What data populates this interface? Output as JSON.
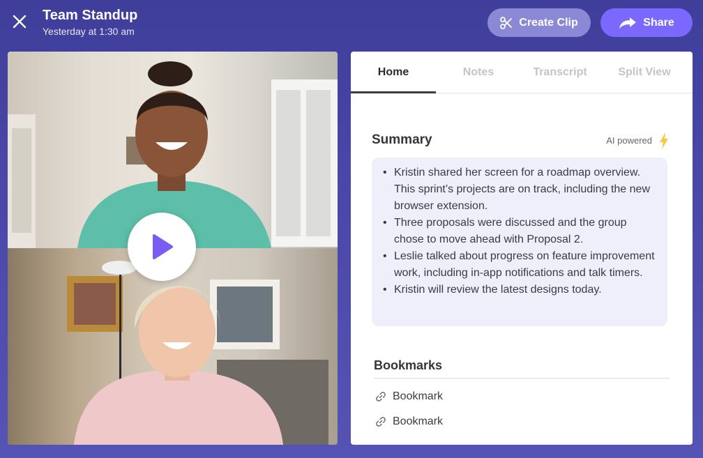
{
  "header": {
    "title": "Team Standup",
    "subtitle": "Yesterday at 1:30 am",
    "close_icon": "close-icon",
    "clip_label": "Create Clip",
    "clip_icon": "scissors-icon",
    "share_label": "Share",
    "share_icon": "share-arrow-icon"
  },
  "video": {
    "play_icon": "play-icon"
  },
  "tabs": [
    {
      "label": "Home",
      "active": true
    },
    {
      "label": "Notes",
      "active": false
    },
    {
      "label": "Transcript",
      "active": false
    },
    {
      "label": "Split View",
      "active": false
    }
  ],
  "summary": {
    "heading": "Summary",
    "ai_label": "AI powered",
    "ai_icon": "lightning-icon",
    "items": [
      "Kristin shared her screen for a roadmap overview. This sprint’s projects are on track, including the new browser extension.",
      "Three proposals were discussed and the group chose to move ahead with Proposal 2.",
      "Leslie talked about progress on feature improvement work, including in-app notifications and talk timers.",
      "Kristin will review the latest designs today."
    ]
  },
  "bookmarks": {
    "heading": "Bookmarks",
    "items": [
      {
        "label": "Bookmark",
        "icon": "link-icon"
      },
      {
        "label": "Bookmark",
        "icon": "link-icon"
      }
    ]
  },
  "colors": {
    "background": "#4a47a8",
    "share_button": "#7b69ff",
    "clip_button": "#8b88d6",
    "summary_box": "#efeefb",
    "ai_icon": "#f5c842"
  }
}
